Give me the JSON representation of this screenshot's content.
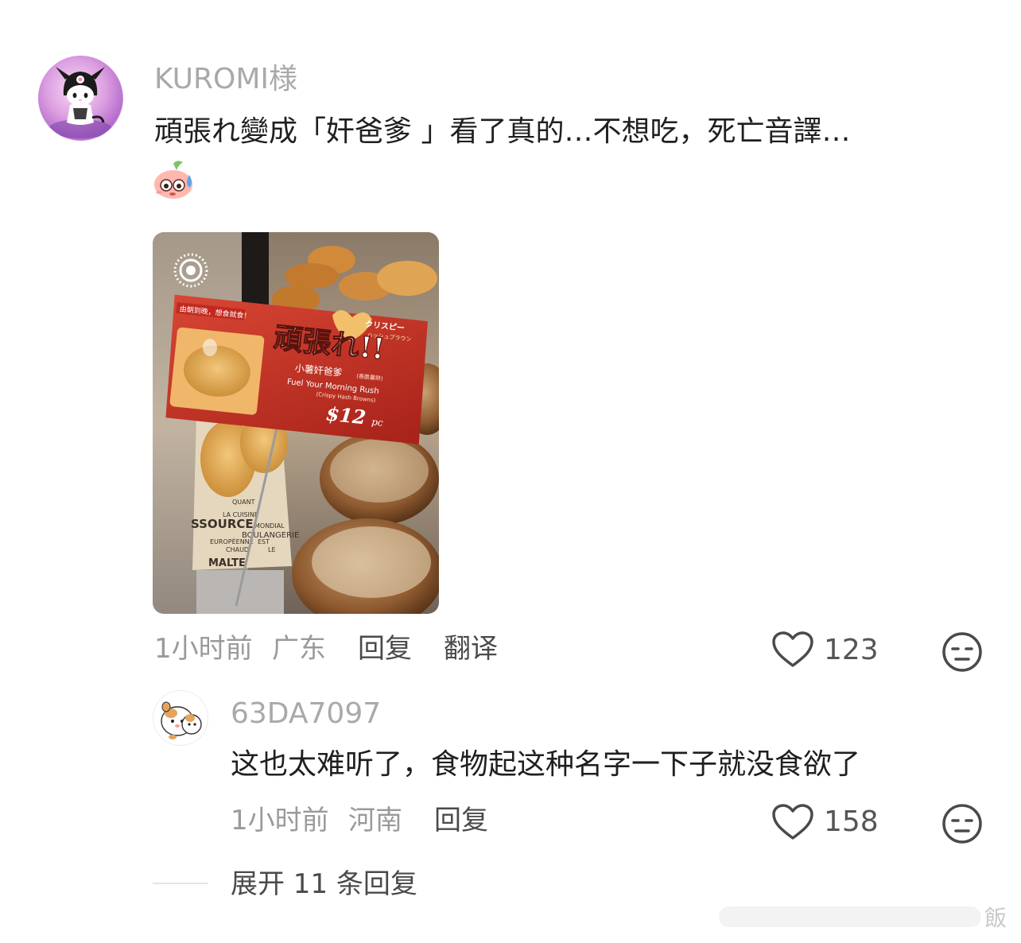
{
  "comment": {
    "username": "KUROMI様",
    "text_line1": "頑張れ變成「奸爸爹 」看了真的…不想吃，死亡音譯…",
    "emoji": "sweat-face-emoji",
    "photo": {
      "sign_tagline": "由朝到晚，想食就食！",
      "sign_title": "頑張れ!!",
      "sign_badge_top": "クリスピー",
      "sign_badge_bottom": "ハッシュブラウン",
      "sign_chinese": "小薯奸爸爹",
      "sign_chinese_small": "(香脆薯餅)",
      "sign_english": "Fuel Your Morning Rush",
      "sign_english_small": "(Crispy Hash Browns)",
      "sign_price": "$12",
      "sign_price_unit": "pc",
      "bag_text": [
        "QUANT",
        "LA CUISINE",
        "SSOURCE",
        "MONDIAL",
        "BOULANGERIE",
        "EUROPÉENNE",
        "EST",
        "CHAUD",
        "LE",
        "MALTE"
      ]
    },
    "time": "1小时前",
    "location": "广东",
    "reply_label": "回复",
    "translate_label": "翻译",
    "like_count": "123"
  },
  "reply": {
    "username": "63DA7097",
    "text": "这也太难听了，食物起这种名字一下子就没食欲了",
    "time": "1小时前",
    "location": "河南",
    "reply_label": "回复",
    "like_count": "158"
  },
  "expand_label": "展开 11 条回复",
  "watermark_char": "飯",
  "colors": {
    "username": "#a9a9a9",
    "text": "#1f1f1f",
    "meta": "#9a9a9a",
    "sign_red": "#c8352a"
  }
}
